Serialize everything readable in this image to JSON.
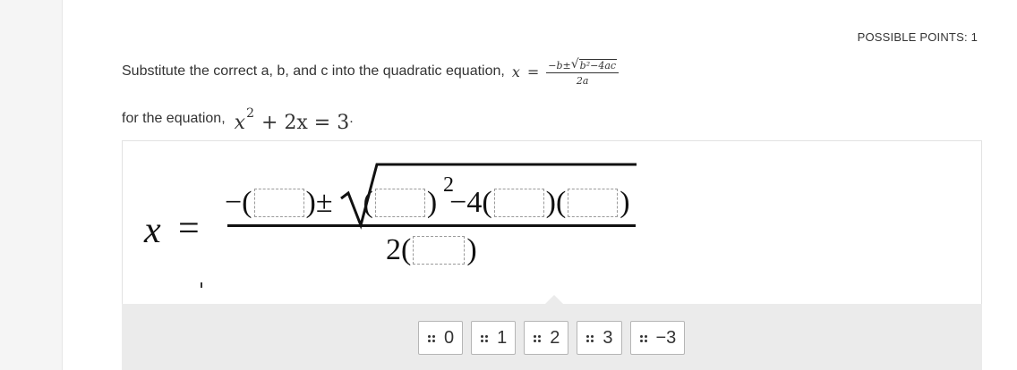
{
  "header": {
    "points_label": "POSSIBLE POINTS: 1"
  },
  "question": {
    "line1_text": "Substitute the correct a, b, and c into the quadratic equation,",
    "formula": {
      "lhs": "x",
      "equals": "=",
      "numerator_prefix": "−b±",
      "radicand": "b²−4ac",
      "denominator": "2a"
    },
    "line2_text": "for the equation,",
    "equation": {
      "base": "x",
      "exp": "2",
      "rest": "+ 2x = 3"
    },
    "line2_end": "."
  },
  "workspace": {
    "lhs": "x",
    "equals": "=",
    "neg_open": "−(",
    "pm": ")±",
    "sq_open": "(",
    "sq_close": ")",
    "exponent": "2",
    "minus_four": "−4(",
    "mid": ")(",
    "end": ")",
    "den_open": "2(",
    "den_close": ")"
  },
  "answer_bank": {
    "chips": [
      {
        "label": "0"
      },
      {
        "label": "1"
      },
      {
        "label": "2"
      },
      {
        "label": "3"
      },
      {
        "label": "−3"
      }
    ]
  }
}
